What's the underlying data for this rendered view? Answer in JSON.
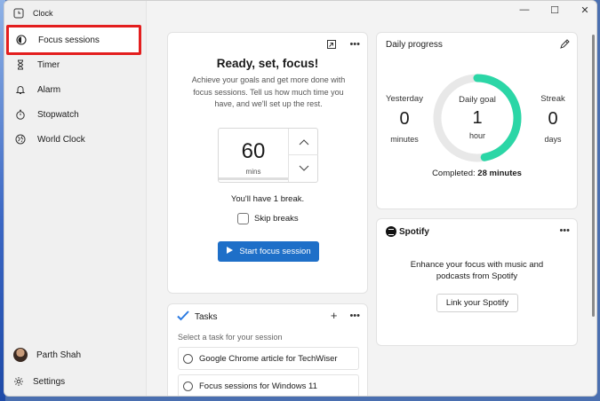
{
  "app": {
    "title": "Clock"
  },
  "sidebar": {
    "items": [
      {
        "label": "Focus sessions"
      },
      {
        "label": "Timer"
      },
      {
        "label": "Alarm"
      },
      {
        "label": "Stopwatch"
      },
      {
        "label": "World Clock"
      }
    ],
    "profile": "Parth Shah",
    "settings": "Settings"
  },
  "focus": {
    "title": "Ready, set, focus!",
    "description": "Achieve your goals and get more done with focus sessions. Tell us how much time you have, and we'll set up the rest.",
    "minutes": "60",
    "unit": "mins",
    "break_text": "You'll have 1 break.",
    "skip_label": "Skip breaks",
    "start_label": "Start focus session"
  },
  "progress": {
    "title": "Daily progress",
    "yesterday": {
      "label": "Yesterday",
      "value": "0",
      "unit": "minutes"
    },
    "goal": {
      "label": "Daily goal",
      "value": "1",
      "unit": "hour"
    },
    "streak": {
      "label": "Streak",
      "value": "0",
      "unit": "days"
    },
    "completed_label": "Completed:",
    "completed_value": "28 minutes",
    "ring_fraction": 0.47,
    "accent": "#2bd6a6"
  },
  "spotify": {
    "brand": "Spotify",
    "description_1": "Enhance your focus with music and",
    "description_2": "podcasts from Spotify",
    "button": "Link your Spotify"
  },
  "tasks": {
    "title": "Tasks",
    "hint": "Select a task for your session",
    "items": [
      {
        "label": "Google Chrome article for TechWiser"
      },
      {
        "label": "Focus sessions for Windows 11"
      }
    ]
  },
  "colors": {
    "primary": "#1e6fc8",
    "highlight": "#e31e1e"
  },
  "icons": {
    "more": "•••",
    "minimize": "—",
    "maximize": "☐",
    "close": "✕"
  }
}
